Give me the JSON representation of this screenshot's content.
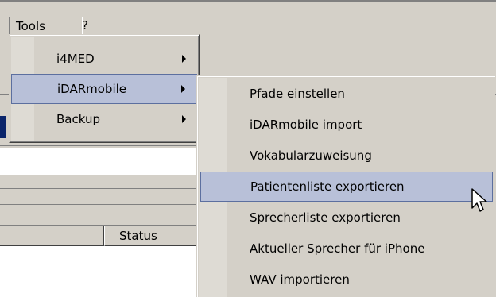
{
  "menubar": {
    "items": [
      {
        "label": "Tools"
      },
      {
        "label": "?"
      }
    ]
  },
  "tools_menu": {
    "items": [
      {
        "label": "i4MED"
      },
      {
        "label": "iDARmobile"
      },
      {
        "label": "Backup"
      }
    ]
  },
  "submenu": {
    "items": [
      {
        "label": "Pfade einstellen"
      },
      {
        "label": "iDARmobile import"
      },
      {
        "label": "Vokabularzuweisung"
      },
      {
        "label": "Patientenliste exportieren"
      },
      {
        "label": "Sprecherliste exportieren"
      },
      {
        "label": "Aktueller Sprecher für iPhone"
      },
      {
        "label": "WAV importieren"
      }
    ]
  },
  "list": {
    "status_header": "Status"
  },
  "colors": {
    "face": "#d4d0c8",
    "highlight": "#b8c0d8",
    "highlight_border": "#5c6f9f"
  }
}
